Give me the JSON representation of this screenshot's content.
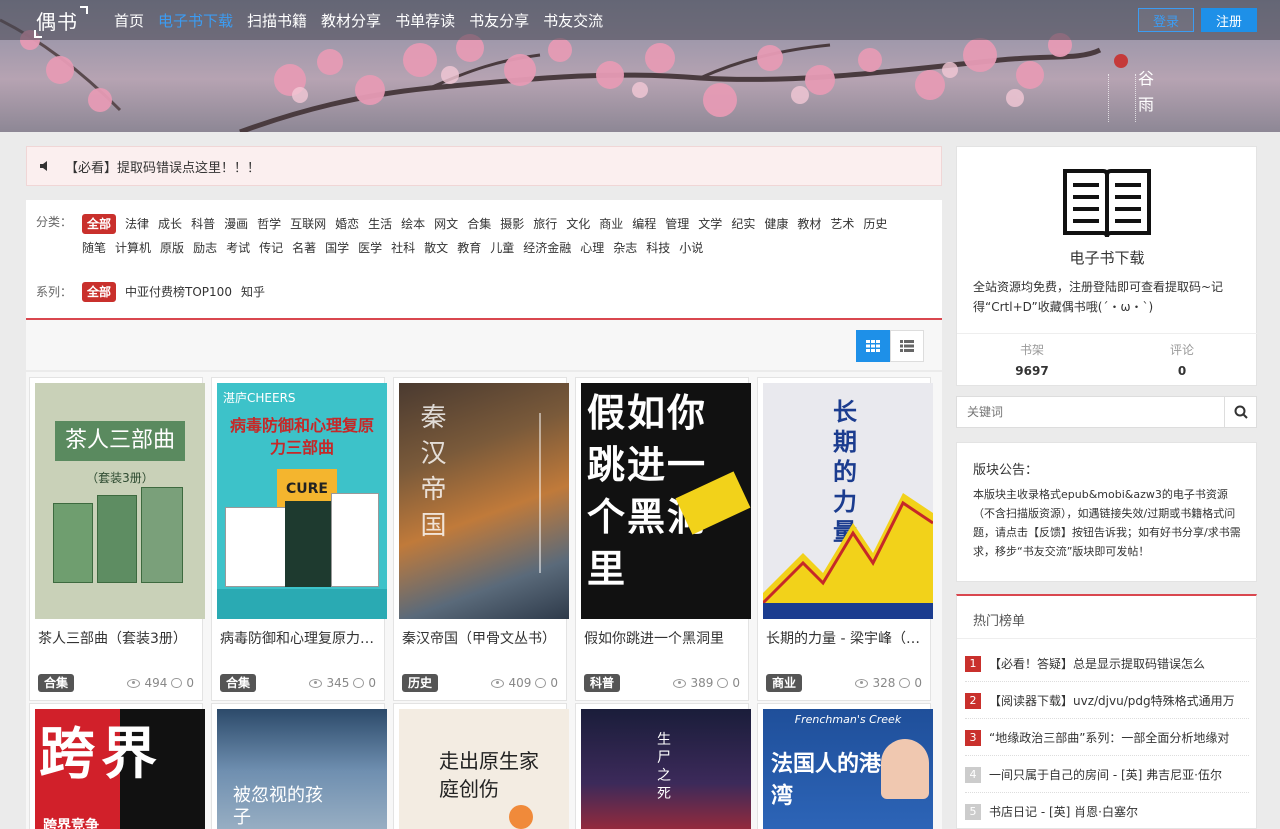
{
  "header": {
    "logo": "偶书",
    "nav": [
      "首页",
      "电子书下载",
      "扫描书籍",
      "教材分享",
      "书单荐读",
      "书友分享",
      "书友交流"
    ],
    "active_index": 1,
    "login_label": "登录",
    "register_label": "注册",
    "banner_term": "谷雨"
  },
  "notice": {
    "text": "【必看】提取码错误点这里！！！"
  },
  "filter": {
    "category_label": "分类：",
    "categories": [
      "全部",
      "法律",
      "成长",
      "科普",
      "漫画",
      "哲学",
      "互联网",
      "婚恋",
      "生活",
      "绘本",
      "网文",
      "合集",
      "摄影",
      "旅行",
      "文化",
      "商业",
      "编程",
      "管理",
      "文学",
      "纪实",
      "健康",
      "教材",
      "艺术",
      "历史",
      "随笔",
      "计算机",
      "原版",
      "励志",
      "考试",
      "传记",
      "名著",
      "国学",
      "医学",
      "社科",
      "散文",
      "教育",
      "儿童",
      "经济金融",
      "心理",
      "杂志",
      "科技",
      "小说"
    ],
    "series_label": "系列：",
    "series": [
      "全部",
      "中亚付费榜TOP100",
      "知乎"
    ]
  },
  "books": [
    {
      "title": "茶人三部曲（套装3册）",
      "category": "合集",
      "views": "494",
      "comments": "0",
      "cover_text": "茶人三部曲",
      "cover_sub": "（套装3册）"
    },
    {
      "title": "病毒防御和心理复原力三部曲",
      "category": "合集",
      "views": "345",
      "comments": "0",
      "cover_text": "病毒防御和心理复原力三部曲",
      "cover_sub": "湛庐CHEERS"
    },
    {
      "title": "秦汉帝国（甲骨文丛书）",
      "category": "历史",
      "views": "409",
      "comments": "0",
      "cover_text": "秦汉帝国",
      "cover_sub": ""
    },
    {
      "title": "假如你跳进一个黑洞里",
      "category": "科普",
      "views": "389",
      "comments": "0",
      "cover_text": "假如你跳进一个黑洞里",
      "cover_sub": ""
    },
    {
      "title": "长期的力量 - 梁宇峰（著）",
      "category": "商业",
      "views": "328",
      "comments": "0",
      "cover_text": "长期的力量",
      "cover_sub": ""
    }
  ],
  "books_row2": [
    {
      "cover_text": "跨界",
      "cover_sub": "跨界竞争"
    },
    {
      "cover_text": "被忽视的孩子",
      "cover_sub": ""
    },
    {
      "cover_text": "走出原生家庭创伤",
      "cover_sub": ""
    },
    {
      "cover_text": "生尸之死",
      "cover_sub": ""
    },
    {
      "cover_text": "法国人的港湾",
      "cover_sub": "Frenchman's Creek"
    }
  ],
  "sidebar": {
    "ebook": {
      "title": "电子书下载",
      "desc": "全站资源均免费，注册登陆即可查看提取码~记得“Crtl+D”收藏偶书哦(´・ω・`)",
      "shelf_label": "书架",
      "shelf_value": "9697",
      "comment_label": "评论",
      "comment_value": "0"
    },
    "search_placeholder": "关键词",
    "board": {
      "title": "版块公告：",
      "text": "本版块主收录格式epub&mobi&azw3的电子书资源（不含扫描版资源），如遇链接失效/过期或书籍格式问题，请点击【反馈】按钮告诉我；如有好书分享/求书需求，移步“书友交流”版块即可发帖！"
    },
    "hot": {
      "title": "热门榜单",
      "items": [
        {
          "num": "1",
          "text": "【必看！答疑】总是显示提取码错误怎么"
        },
        {
          "num": "2",
          "text": "【阅读器下载】uvz/djvu/pdg特殊格式通用万"
        },
        {
          "num": "3",
          "text": "“地缘政治三部曲”系列：一部全面分析地缘对"
        },
        {
          "num": "4",
          "text": "一间只属于自己的房间 - [英] 弗吉尼亚·伍尔"
        },
        {
          "num": "5",
          "text": "书店日记 - [英] 肖恩·白塞尔"
        }
      ]
    }
  },
  "colors": {
    "accent": "#1e90e8",
    "red": "#c9302c"
  }
}
